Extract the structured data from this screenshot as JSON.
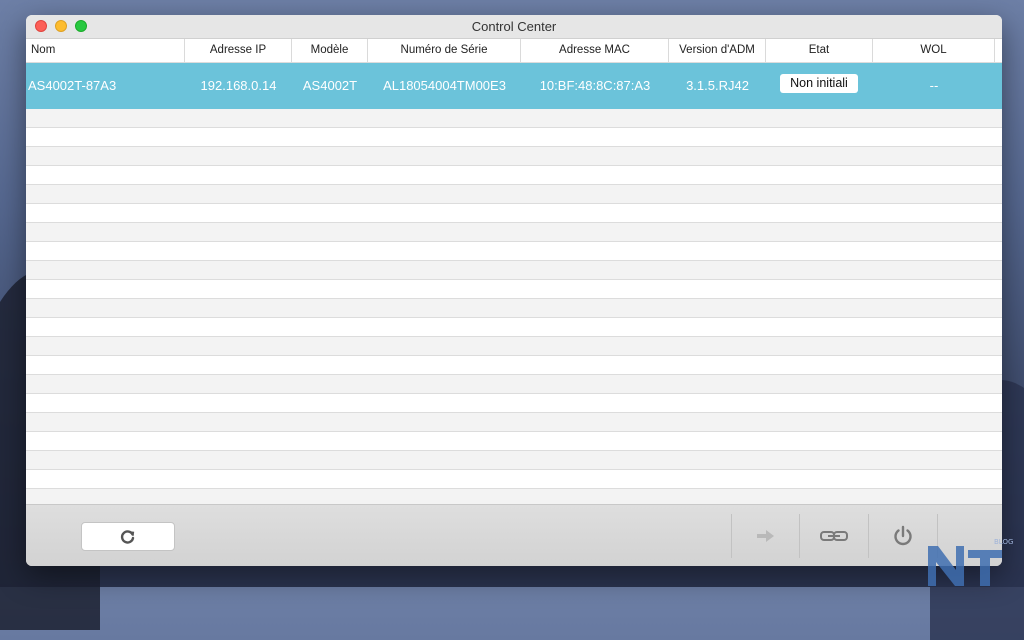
{
  "window": {
    "title": "Control Center"
  },
  "table": {
    "columns": [
      "Nom",
      "Adresse IP",
      "Modèle",
      "Numéro de Série",
      "Adresse MAC",
      "Version d'ADM",
      "Etat",
      "WOL"
    ],
    "rows": [
      {
        "name": "AS4002T-87A3",
        "ip": "192.168.0.14",
        "model": "AS4002T",
        "serial": "AL18054004TM00E3",
        "mac": "10:BF:48:8C:87:A3",
        "adm_version": "3.1.5.RJ42",
        "state": "Non initiali",
        "wol": "--"
      }
    ]
  },
  "toolbar": {
    "refresh_icon": "refresh-icon",
    "connect_icon": "arrow-right-icon",
    "link_icon": "link-icon",
    "power_icon": "power-icon"
  },
  "watermark": {
    "text": "BLOG"
  },
  "colors": {
    "selection": "#6bc3da"
  }
}
